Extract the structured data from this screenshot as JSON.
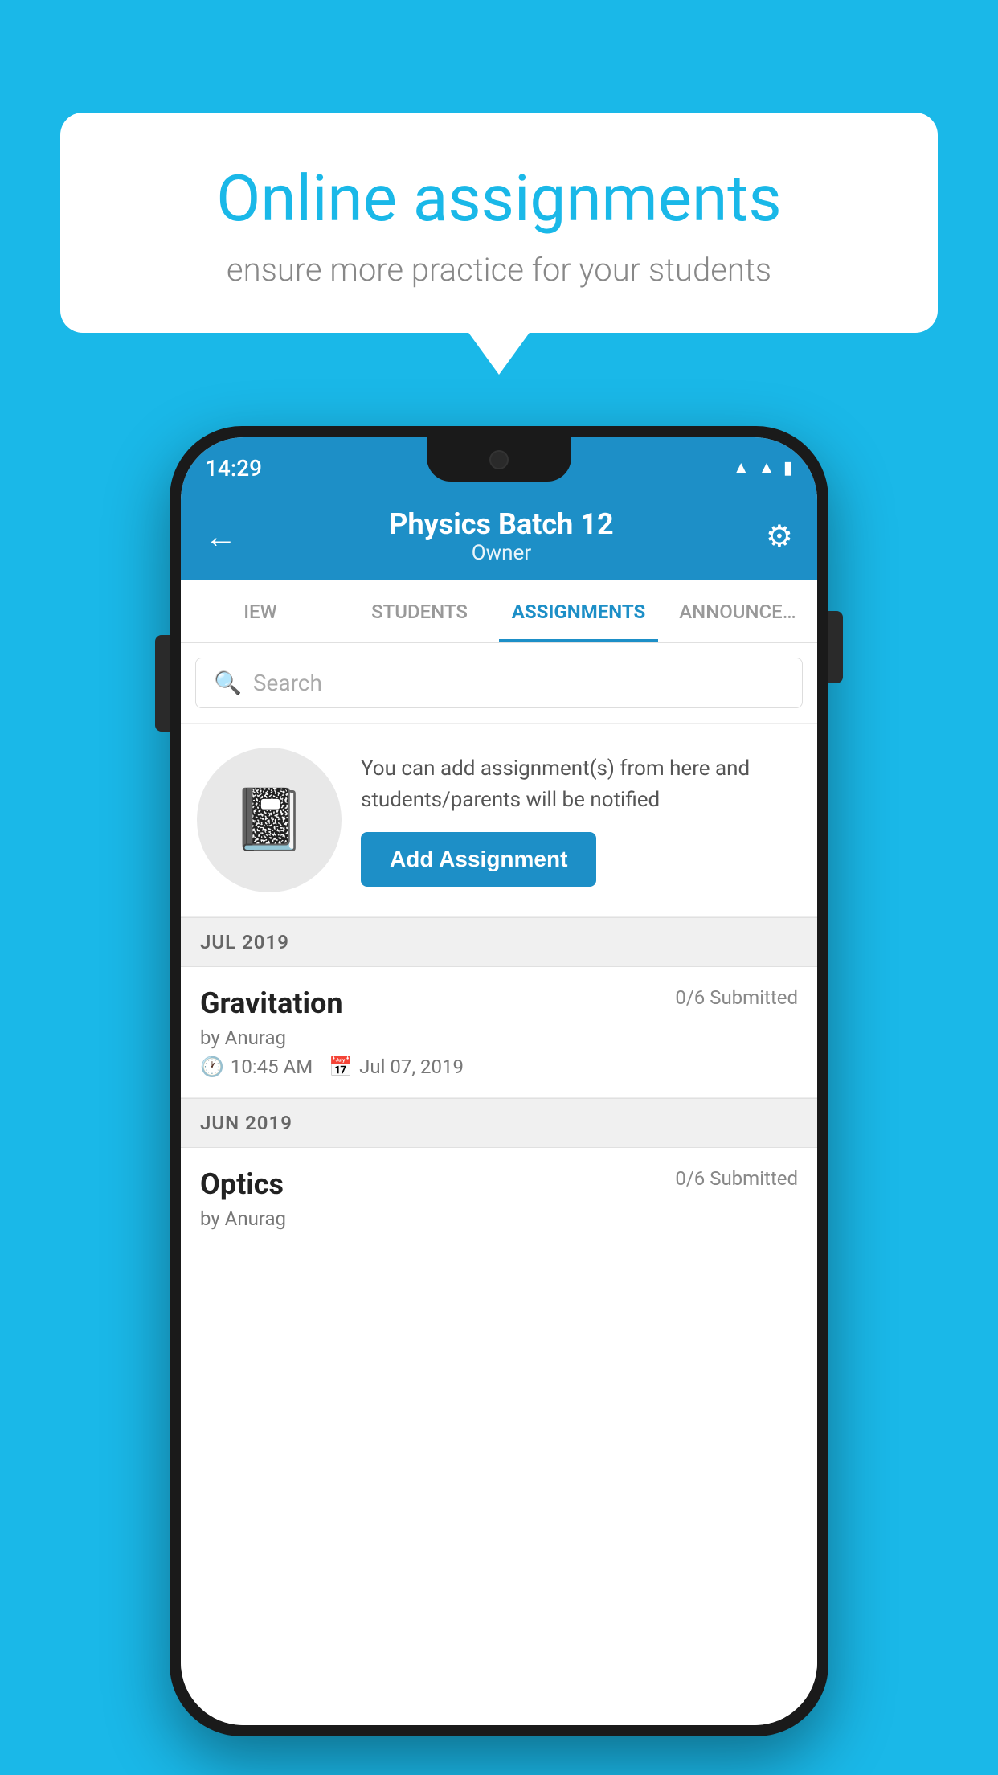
{
  "background_color": "#1ab8e8",
  "speech_bubble": {
    "title": "Online assignments",
    "subtitle": "ensure more practice for your students"
  },
  "status_bar": {
    "time": "14:29",
    "icons": [
      "wifi",
      "signal",
      "battery"
    ]
  },
  "app_bar": {
    "title": "Physics Batch 12",
    "subtitle": "Owner",
    "back_label": "←",
    "settings_label": "⚙"
  },
  "tabs": [
    {
      "label": "IEW",
      "active": false
    },
    {
      "label": "STUDENTS",
      "active": false
    },
    {
      "label": "ASSIGNMENTS",
      "active": true
    },
    {
      "label": "ANNOUNCEMENTS",
      "active": false
    }
  ],
  "search": {
    "placeholder": "Search"
  },
  "empty_state": {
    "description": "You can add assignment(s) from here and students/parents will be notified",
    "button_label": "Add Assignment"
  },
  "sections": [
    {
      "header": "JUL 2019",
      "assignments": [
        {
          "name": "Gravitation",
          "submitted": "0/6 Submitted",
          "author": "by Anurag",
          "time": "10:45 AM",
          "date": "Jul 07, 2019"
        }
      ]
    },
    {
      "header": "JUN 2019",
      "assignments": [
        {
          "name": "Optics",
          "submitted": "0/6 Submitted",
          "author": "by Anurag",
          "time": "",
          "date": ""
        }
      ]
    }
  ]
}
